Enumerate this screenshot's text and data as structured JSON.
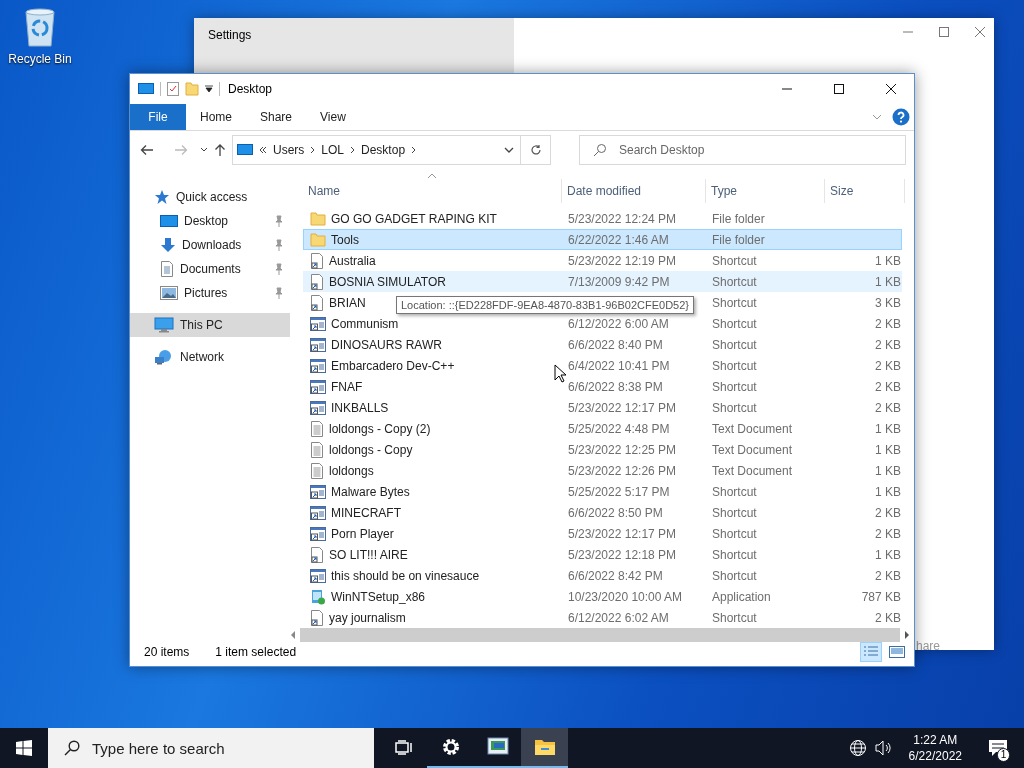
{
  "desktop_icons": [
    {
      "label": "Recycle Bin"
    }
  ],
  "settings_window": {
    "title": "Settings",
    "partial_text": "hare"
  },
  "explorer": {
    "title": "Desktop",
    "ribbon_tabs": [
      {
        "label": "File",
        "kind": "file"
      },
      {
        "label": "Home",
        "kind": "tab"
      },
      {
        "label": "Share",
        "kind": "tab"
      },
      {
        "label": "View",
        "kind": "tab"
      }
    ],
    "breadcrumb": [
      "Users",
      "LOL",
      "Desktop"
    ],
    "search": {
      "placeholder": "Search Desktop"
    },
    "sidebar": [
      {
        "label": "Quick access",
        "kind": "star",
        "selected": false,
        "children": [
          {
            "label": "Desktop",
            "kind": "desktop",
            "pinned": true,
            "selected": false
          },
          {
            "label": "Downloads",
            "kind": "download",
            "pinned": true,
            "selected": false
          },
          {
            "label": "Documents",
            "kind": "documents",
            "pinned": true,
            "selected": false
          },
          {
            "label": "Pictures",
            "kind": "pictures",
            "pinned": true,
            "selected": false
          }
        ]
      },
      {
        "label": "This PC",
        "kind": "pc",
        "selected": true
      },
      {
        "label": "Network",
        "kind": "network",
        "selected": false
      }
    ],
    "columns": [
      "Name",
      "Date modified",
      "Type",
      "Size"
    ],
    "rows": [
      {
        "name": "GO GO GADGET RAPING KIT",
        "date": "5/23/2022 12:24 PM",
        "type": "File folder",
        "kind": "folder",
        "selected": false,
        "hovered": false
      },
      {
        "name": "Tools",
        "date": "6/22/2022 1:46 AM",
        "type": "File folder",
        "kind": "folder",
        "selected": true,
        "hovered": false
      },
      {
        "name": "Australia",
        "date": "5/23/2022 12:19 PM",
        "type": "Shortcut",
        "size": "1 KB",
        "kind": "shortcut",
        "selected": false,
        "hovered": false
      },
      {
        "name": "BOSNIA SIMULATOR",
        "date": "7/13/2009 9:42 PM",
        "type": "Shortcut",
        "size": "1 KB",
        "kind": "shortcut",
        "selected": false,
        "hovered": true
      },
      {
        "name": "BRIAN",
        "type": "Shortcut",
        "size": "3 KB",
        "kind": "shortcut",
        "selected": false,
        "hovered": false
      },
      {
        "name": "Communism",
        "date": "6/12/2022 6:00 AM",
        "type": "Shortcut",
        "size": "2 KB",
        "kind": "app-shortcut",
        "selected": false,
        "hovered": false
      },
      {
        "name": "DINOSAURS RAWR",
        "date": "6/6/2022 8:40 PM",
        "type": "Shortcut",
        "size": "2 KB",
        "kind": "app-shortcut",
        "selected": false,
        "hovered": false
      },
      {
        "name": "Embarcadero Dev-C++",
        "date": "6/4/2022 10:41 PM",
        "type": "Shortcut",
        "size": "2 KB",
        "kind": "app-shortcut",
        "selected": false,
        "hovered": false
      },
      {
        "name": "FNAF",
        "date": "6/6/2022 8:38 PM",
        "type": "Shortcut",
        "size": "2 KB",
        "kind": "app-shortcut",
        "selected": false,
        "hovered": false
      },
      {
        "name": "INKBALLS",
        "date": "5/23/2022 12:17 PM",
        "type": "Shortcut",
        "size": "2 KB",
        "kind": "app-shortcut",
        "selected": false,
        "hovered": false
      },
      {
        "name": "loldongs - Copy (2)",
        "date": "5/25/2022 4:48 PM",
        "type": "Text Document",
        "size": "1 KB",
        "kind": "text",
        "selected": false,
        "hovered": false
      },
      {
        "name": "loldongs - Copy",
        "date": "5/23/2022 12:25 PM",
        "type": "Text Document",
        "size": "1 KB",
        "kind": "text",
        "selected": false,
        "hovered": false
      },
      {
        "name": "loldongs",
        "date": "5/23/2022 12:26 PM",
        "type": "Text Document",
        "size": "1 KB",
        "kind": "text",
        "selected": false,
        "hovered": false
      },
      {
        "name": "Malware Bytes",
        "date": "5/25/2022 5:17 PM",
        "type": "Shortcut",
        "size": "1 KB",
        "kind": "app-shortcut",
        "selected": false,
        "hovered": false
      },
      {
        "name": "MINECRAFT",
        "date": "6/6/2022 8:50 PM",
        "type": "Shortcut",
        "size": "2 KB",
        "kind": "app-shortcut",
        "selected": false,
        "hovered": false
      },
      {
        "name": "Porn Player",
        "date": "5/23/2022 12:17 PM",
        "type": "Shortcut",
        "size": "2 KB",
        "kind": "app-shortcut",
        "selected": false,
        "hovered": false
      },
      {
        "name": "SO LIT!!! AIRE",
        "date": "5/23/2022 12:18 PM",
        "type": "Shortcut",
        "size": "1 KB",
        "kind": "shortcut",
        "selected": false,
        "hovered": false
      },
      {
        "name": "this should be on vinesauce",
        "date": "6/6/2022 8:42 PM",
        "type": "Shortcut",
        "size": "2 KB",
        "kind": "app-shortcut",
        "selected": false,
        "hovered": false
      },
      {
        "name": "WinNTSetup_x86",
        "date": "10/23/2020 10:00 AM",
        "type": "Application",
        "size": "787 KB",
        "kind": "application",
        "selected": false,
        "hovered": false
      },
      {
        "name": "yay journalism",
        "date": "6/12/2022 6:02 AM",
        "type": "Shortcut",
        "size": "2 KB",
        "kind": "shortcut",
        "selected": false,
        "hovered": false
      }
    ],
    "tooltip": "Location: ::{ED228FDF-9EA8-4870-83B1-96B02CFE0D52}",
    "status": {
      "count": "20 items",
      "selection": "1 item selected"
    }
  },
  "taskbar": {
    "search_placeholder": "Type here to search",
    "apps": [
      {
        "kind": "task-view",
        "running": false,
        "selected": false
      },
      {
        "kind": "settings",
        "running": true,
        "selected": false
      },
      {
        "kind": "app",
        "running": true,
        "selected": false
      },
      {
        "kind": "explorer",
        "running": true,
        "selected": true
      }
    ],
    "time": "1:22 AM",
    "date": "6/22/2022",
    "notification_count": "1"
  }
}
